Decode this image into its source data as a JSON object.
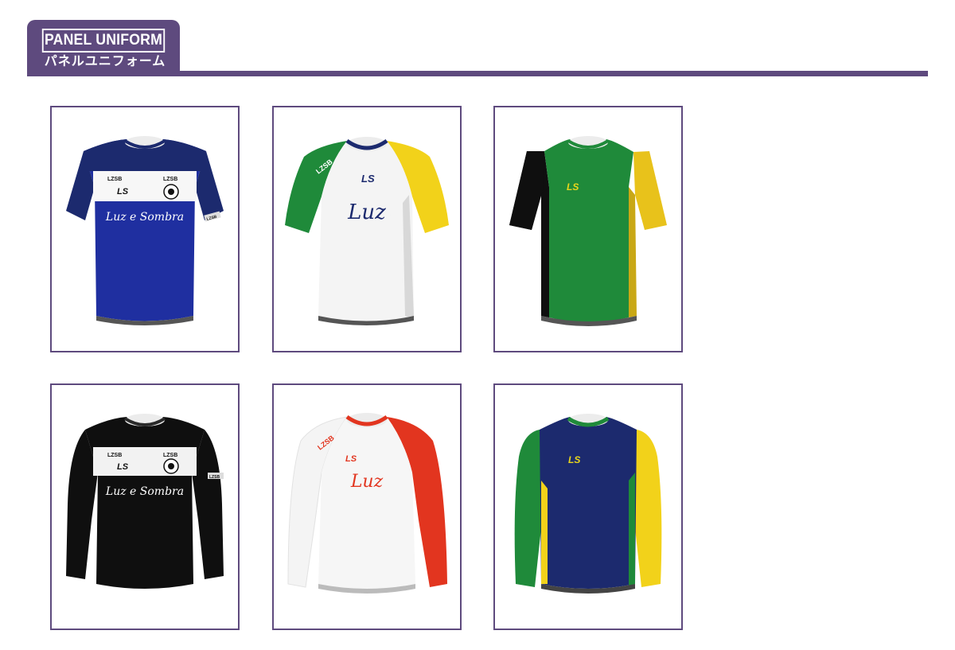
{
  "header": {
    "title_en": "PANEL UNIFORM",
    "title_jp": "パネルユニフォーム"
  },
  "colors": {
    "accent": "#5e4a7e",
    "navy": "#1c2a6e",
    "royal_blue": "#1f2fa0",
    "green": "#1f8a3a",
    "yellow": "#f2d21a",
    "red": "#e2351f",
    "black": "#0f0f0f",
    "white": "#ffffff"
  },
  "uniforms": [
    {
      "style": "short-sleeve",
      "colorway": "navy / royal blue / white band",
      "brand_left": "LZSB",
      "brand_right": "LZSB",
      "logo": "LS",
      "script": "Luz e Sombra",
      "sleeve_tag": "LZSB"
    },
    {
      "style": "short-sleeve raglan",
      "colorway": "white / green / yellow",
      "sleeve_brand": "LZSB",
      "logo": "LS",
      "script": "Luz"
    },
    {
      "style": "short-sleeve",
      "colorway": "green / black / yellow",
      "logo": "LS"
    },
    {
      "style": "long-sleeve",
      "colorway": "black / white band",
      "brand_left": "LZSB",
      "brand_right": "LZSB",
      "logo": "LS",
      "script": "Luz e Sombra",
      "sleeve_tag": "LZSB"
    },
    {
      "style": "long-sleeve raglan",
      "colorway": "white / red",
      "sleeve_brand": "LZSB",
      "logo": "LS",
      "script": "Luz"
    },
    {
      "style": "long-sleeve",
      "colorway": "navy / green / yellow",
      "logo": "LS"
    }
  ]
}
